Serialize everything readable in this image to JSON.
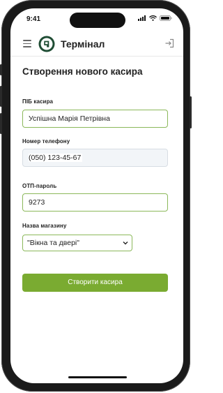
{
  "status_bar": {
    "time": "9:41",
    "icons": [
      "signal-icon",
      "wifi-icon",
      "battery-icon"
    ]
  },
  "header": {
    "app_title": "Термінал",
    "logo_icon": "shop-logo-icon",
    "menu_icon": "hamburger-menu-icon",
    "logout_icon": "logout-icon"
  },
  "page": {
    "title": "Створення нового касира"
  },
  "form": {
    "full_name": {
      "label": "ПІБ касира",
      "value": "Успішна Марія Петрівна"
    },
    "phone": {
      "label": "Номер телефону",
      "value": "(050) 123-45-67"
    },
    "otp": {
      "label": "ОТП-пароль",
      "value": "9273"
    },
    "store": {
      "label": "Назва магазину",
      "selected": "\"Вікна та двері\""
    },
    "submit_label": "Створити касира"
  },
  "colors": {
    "accent": "#7aab31",
    "input_border": "#8bb85a",
    "logo_bg": "#1f4d34"
  }
}
